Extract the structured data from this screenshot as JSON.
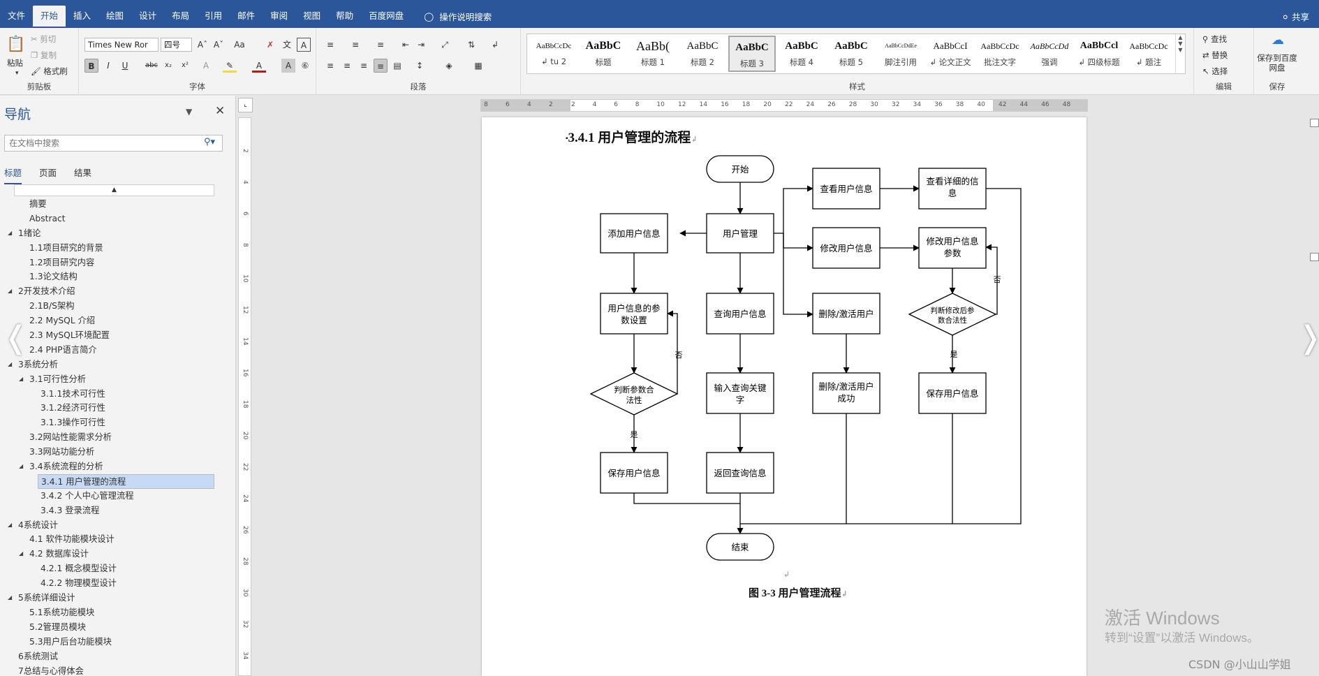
{
  "tabs": [
    "文件",
    "开始",
    "插入",
    "绘图",
    "设计",
    "布局",
    "引用",
    "邮件",
    "审阅",
    "视图",
    "帮助",
    "百度网盘"
  ],
  "tell_me": "操作说明搜索",
  "share": "共享",
  "ribbon": {
    "clipboard": {
      "paste": "粘贴",
      "cut": "剪切",
      "copy": "复制",
      "format_painter": "格式刷",
      "label": "剪贴板"
    },
    "font": {
      "name": "Times New Ror",
      "size": "四号",
      "label": "字体"
    },
    "paragraph": {
      "label": "段落"
    },
    "styles": {
      "label": "样式",
      "items": [
        {
          "sample": "AaBbCcDc",
          "name": "↲ tu 2"
        },
        {
          "sample": "AaBbC",
          "name": "标题"
        },
        {
          "sample": "AaBb(",
          "name": "标题 1"
        },
        {
          "sample": "AaBbC",
          "name": "标题 2"
        },
        {
          "sample": "AaBbC",
          "name": "标题 3"
        },
        {
          "sample": "AaBbC",
          "name": "标题 4"
        },
        {
          "sample": "AaBbC",
          "name": "标题 5"
        },
        {
          "sample": "AaBbCcDdEe",
          "name": "脚注引用"
        },
        {
          "sample": "AaBbCcI",
          "name": "↲ 论文正文"
        },
        {
          "sample": "AaBbCcDc",
          "name": "批注文字"
        },
        {
          "sample": "AaBbCcDd",
          "name": "强调"
        },
        {
          "sample": "AaBbCcl",
          "name": "↲ 四级标题"
        },
        {
          "sample": "AaBbCcDc",
          "name": "↲ 题注"
        }
      ]
    },
    "editing": {
      "find": "查找",
      "replace": "替换",
      "select": "选择",
      "label": "编辑"
    },
    "save": {
      "button": "保存到百度网盘",
      "label": "保存"
    }
  },
  "nav": {
    "title": "导航",
    "search_placeholder": "在文档中搜索",
    "tabs": [
      "标题",
      "页面",
      "结果"
    ],
    "outline": [
      {
        "text": "摘要",
        "level": 1,
        "tri": false
      },
      {
        "text": "Abstract",
        "level": 1,
        "tri": false
      },
      {
        "text": "1绪论",
        "level": 0,
        "tri": true
      },
      {
        "text": "1.1项目研究的背景",
        "level": 1,
        "tri": false
      },
      {
        "text": "1.2项目研究内容",
        "level": 1,
        "tri": false
      },
      {
        "text": "1.3论文结构",
        "level": 1,
        "tri": false
      },
      {
        "text": "2开发技术介绍",
        "level": 0,
        "tri": true
      },
      {
        "text": "2.1B/S架构",
        "level": 1,
        "tri": false
      },
      {
        "text": "2.2 MySQL 介绍",
        "level": 1,
        "tri": false
      },
      {
        "text": "2.3 MySQL环境配置",
        "level": 1,
        "tri": false
      },
      {
        "text": "2.4 PHP语言简介",
        "level": 1,
        "tri": false
      },
      {
        "text": "3系统分析",
        "level": 0,
        "tri": true
      },
      {
        "text": "3.1可行性分析",
        "level": 1,
        "tri": true
      },
      {
        "text": "3.1.1技术可行性",
        "level": 2,
        "tri": false
      },
      {
        "text": "3.1.2经济可行性",
        "level": 2,
        "tri": false
      },
      {
        "text": "3.1.3操作可行性",
        "level": 2,
        "tri": false
      },
      {
        "text": "3.2网站性能需求分析",
        "level": 1,
        "tri": false
      },
      {
        "text": "3.3网站功能分析",
        "level": 1,
        "tri": false
      },
      {
        "text": "3.4系统流程的分析",
        "level": 1,
        "tri": true
      },
      {
        "text": "3.4.1 用户管理的流程",
        "level": 2,
        "tri": false,
        "selected": true
      },
      {
        "text": "3.4.2 个人中心管理流程",
        "level": 2,
        "tri": false
      },
      {
        "text": "3.4.3 登录流程",
        "level": 2,
        "tri": false
      },
      {
        "text": "4系统设计",
        "level": 0,
        "tri": true
      },
      {
        "text": "4.1 软件功能模块设计",
        "level": 1,
        "tri": false
      },
      {
        "text": "4.2 数据库设计",
        "level": 1,
        "tri": true
      },
      {
        "text": "4.2.1 概念模型设计",
        "level": 2,
        "tri": false
      },
      {
        "text": "4.2.2 物理模型设计",
        "level": 2,
        "tri": false
      },
      {
        "text": "5系统详细设计",
        "level": 0,
        "tri": true
      },
      {
        "text": "5.1系统功能模块",
        "level": 1,
        "tri": false
      },
      {
        "text": "5.2管理员模块",
        "level": 1,
        "tri": false
      },
      {
        "text": "5.3用户后台功能模块",
        "level": 1,
        "tri": false
      },
      {
        "text": "6系统测试",
        "level": 0,
        "tri": false
      },
      {
        "text": "7总结与心得体会",
        "level": 0,
        "tri": false
      }
    ]
  },
  "ruler": {
    "h_ticks": [
      "8",
      "6",
      "4",
      "2",
      "2",
      "4",
      "6",
      "8",
      "10",
      "12",
      "14",
      "16",
      "18",
      "20",
      "22",
      "24",
      "26",
      "28",
      "30",
      "32",
      "34",
      "36",
      "38",
      "40",
      "42",
      "44",
      "46",
      "48"
    ],
    "v_ticks": [
      "2",
      "4",
      "6",
      "8",
      "10",
      "12",
      "14",
      "16",
      "18",
      "20",
      "22",
      "24",
      "26",
      "28",
      "30",
      "32",
      "34"
    ]
  },
  "doc": {
    "heading": "3.4.1  用户管理的流程",
    "caption": "图 3-3  用户管理流程",
    "flow": {
      "start": "开始",
      "user_mgmt": "用户管理",
      "add_user": "添加用户信息",
      "param_set": "用户信息的参数设置",
      "judge_left": "判断参数合法性",
      "save_left": "保存用户信息",
      "query": "查询用户信息",
      "input_kw": "输入查询关键字",
      "return_q": "返回查询信息",
      "view": "查看用户信息",
      "view_detail": "查看详细的信息",
      "modify": "修改用户信息",
      "modify_param": "修改用户信息参数",
      "judge_right": "判断修改后参数合法性",
      "save_right": "保存用户信息",
      "del_act": "删除/激活用户",
      "del_ok": "删除/激活用户成功",
      "end": "结束",
      "no": "否",
      "yes": "是"
    }
  },
  "watermark": {
    "line1": "激活 Windows",
    "line2": "转到“设置”以激活 Windows。"
  },
  "credit": "CSDN @小山山学姐"
}
